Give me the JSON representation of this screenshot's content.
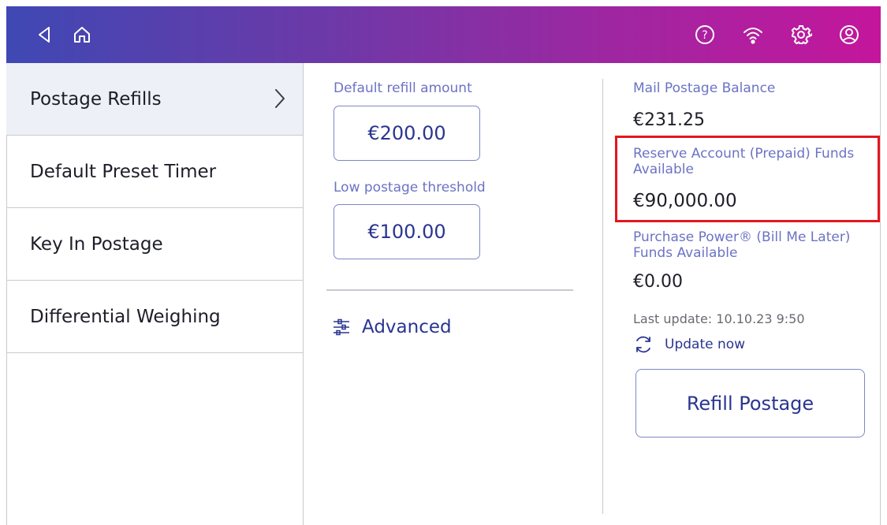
{
  "topbar": {
    "icons": [
      "back-icon",
      "home-icon",
      "help-icon",
      "wifi-icon",
      "settings-icon",
      "account-icon"
    ],
    "help_glyph": "?"
  },
  "sidebar": {
    "items": [
      {
        "label": "Postage Refills",
        "active": true
      },
      {
        "label": "Default Preset Timer"
      },
      {
        "label": "Key In Postage"
      },
      {
        "label": "Differential Weighing"
      }
    ]
  },
  "middle": {
    "default_refill_label": "Default refill amount",
    "default_refill_value": "€200.00",
    "low_threshold_label": "Low postage threshold",
    "low_threshold_value": "€100.00",
    "advanced_label": "Advanced"
  },
  "right": {
    "mail_balance_label": "Mail Postage Balance",
    "mail_balance_value": "€231.25",
    "reserve_label": "Reserve Account (Prepaid) Funds Available",
    "reserve_value": "€90,000.00",
    "purchase_power_label": "Purchase Power® (Bill Me Later) Funds Available",
    "purchase_power_value": "€0.00",
    "last_update": "Last update: 10.10.23 9:50",
    "update_now": "Update now",
    "refill_button": "Refill Postage"
  },
  "colors": {
    "accent_blue": "#2a3590",
    "label_blue": "#6b73c4",
    "highlight_red": "#e3161e",
    "gradient_start": "#3f48b4",
    "gradient_end": "#c4169c"
  }
}
